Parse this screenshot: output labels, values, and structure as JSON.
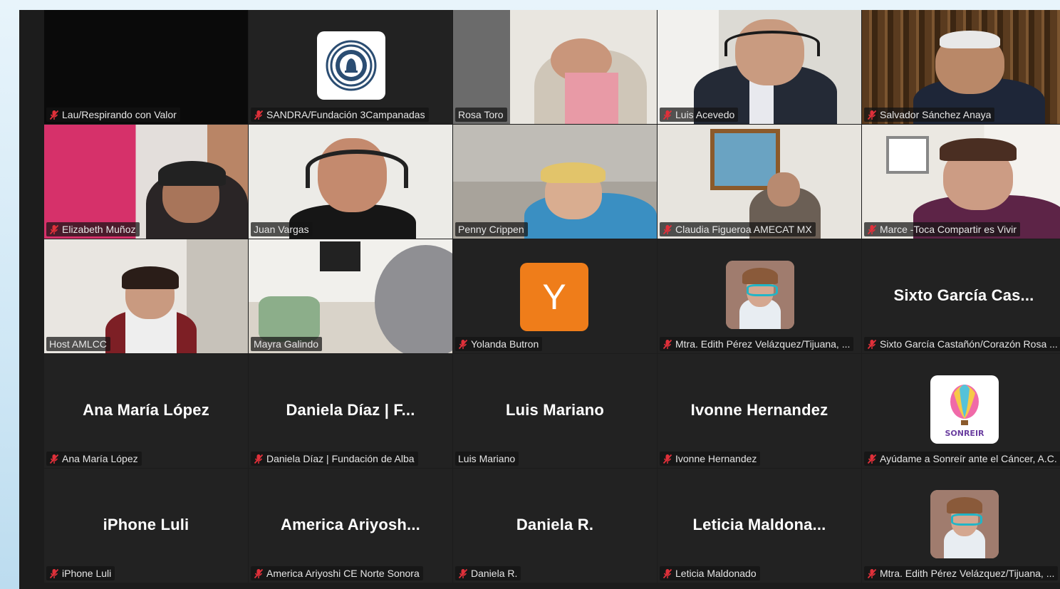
{
  "tiles": [
    {
      "name": "Lau/Respirando con Valor",
      "muted": true,
      "big": "",
      "kind": "black"
    },
    {
      "name": "SANDRA/Fundación 3Campanadas",
      "muted": true,
      "big": "",
      "kind": "logo-bell"
    },
    {
      "name": "Rosa Toro",
      "muted": false,
      "big": "",
      "kind": "video-rosa"
    },
    {
      "name": "Luis Acevedo",
      "muted": true,
      "big": "",
      "kind": "video-luis"
    },
    {
      "name": "Salvador Sánchez Anaya",
      "muted": true,
      "big": "",
      "kind": "video-salvador"
    },
    {
      "name": "Elizabeth Muñoz",
      "muted": true,
      "big": "",
      "kind": "video-elizabeth"
    },
    {
      "name": "Juan Vargas",
      "muted": false,
      "big": "",
      "kind": "video-juan",
      "speaking": true
    },
    {
      "name": "Penny Crippen",
      "muted": false,
      "big": "",
      "kind": "video-penny"
    },
    {
      "name": "Claudia Figueroa AMECAT MX",
      "muted": true,
      "big": "",
      "kind": "video-claudia"
    },
    {
      "name": "Marce -Toca Compartir es Vivir",
      "muted": true,
      "big": "",
      "kind": "video-marce"
    },
    {
      "name": "Host AMLCC",
      "muted": false,
      "big": "",
      "kind": "video-host"
    },
    {
      "name": "Mayra Galindo",
      "muted": false,
      "big": "",
      "kind": "video-mayra"
    },
    {
      "name": "Yolanda Butron",
      "muted": true,
      "big": "",
      "kind": "letter",
      "letter": "Y"
    },
    {
      "name": "Mtra. Edith Pérez Velázquez/Tijuana, ...",
      "muted": true,
      "big": "",
      "kind": "photo"
    },
    {
      "name": "Sixto García Castañón/Corazón Rosa ...",
      "muted": true,
      "big": "Sixto García Cas...",
      "kind": "name"
    },
    {
      "name": "Ana María López",
      "muted": true,
      "big": "Ana María López",
      "kind": "name"
    },
    {
      "name": "Daniela Díaz | Fundación de Alba",
      "muted": true,
      "big": "Daniela Díaz | F...",
      "kind": "name"
    },
    {
      "name": "Luis Mariano",
      "muted": false,
      "big": "Luis Mariano",
      "kind": "name"
    },
    {
      "name": "Ivonne Hernandez",
      "muted": true,
      "big": "Ivonne Hernandez",
      "kind": "name"
    },
    {
      "name": "Ayúdame a Sonreír ante el Cáncer, A.C.",
      "muted": true,
      "big": "",
      "kind": "logo-balloon",
      "logo_text": "SONREIR"
    },
    {
      "name": "iPhone Luli",
      "muted": true,
      "big": "iPhone Luli",
      "kind": "name"
    },
    {
      "name": "America Ariyoshi CE Norte Sonora",
      "muted": true,
      "big": "America  Ariyosh...",
      "kind": "name"
    },
    {
      "name": "Daniela R.",
      "muted": true,
      "big": "Daniela R.",
      "kind": "name"
    },
    {
      "name": "Leticia Maldonado",
      "muted": true,
      "big": "Leticia  Maldona...",
      "kind": "name"
    },
    {
      "name": "Mtra. Edith Pérez Velázquez/Tijuana, ...",
      "muted": true,
      "big": "",
      "kind": "photo"
    }
  ],
  "colors": {
    "tile_bg": "#222222",
    "gallery_bg": "#1c1c1c",
    "speaking_border": "#2fd18c",
    "muted_icon": "#e0303a",
    "avatar_orange": "#ef7d1a"
  },
  "icons": {
    "muted": "mic-muted-icon"
  }
}
